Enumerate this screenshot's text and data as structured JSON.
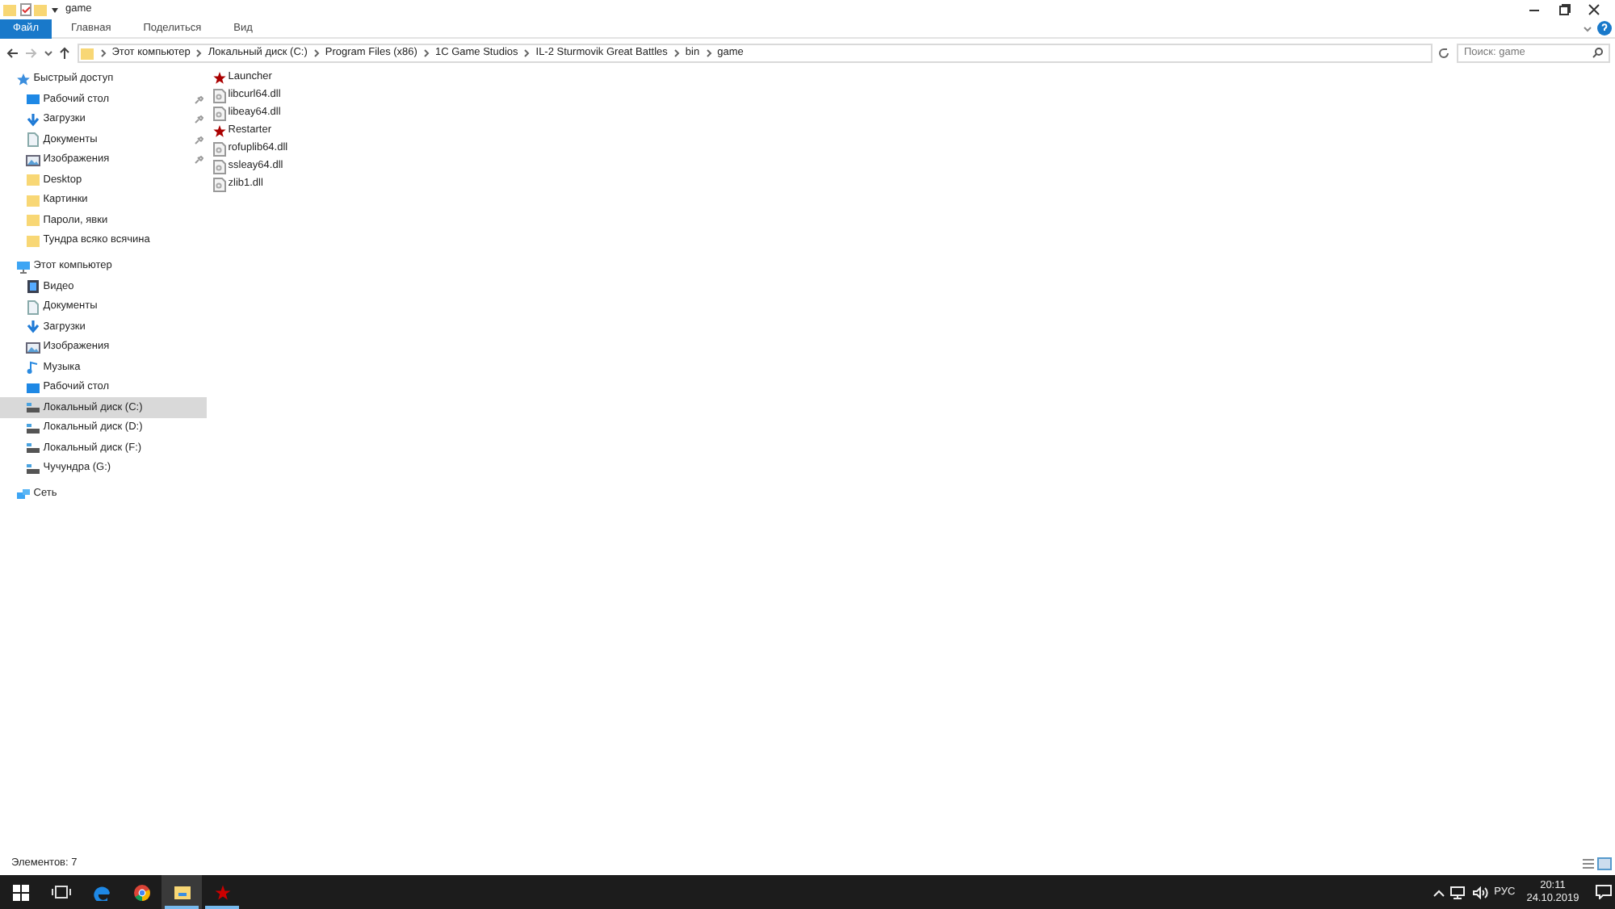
{
  "window": {
    "title": "game"
  },
  "ribbon_tabs": [
    {
      "label": "Файл",
      "selected": true
    },
    {
      "label": "Главная",
      "selected": false
    },
    {
      "label": "Поделиться",
      "selected": false
    },
    {
      "label": "Вид",
      "selected": false
    }
  ],
  "breadcrumbs": [
    "Этот компьютер",
    "Локальный диск (C:)",
    "Program Files (x86)",
    "1C Game Studios",
    "IL-2 Sturmovik Great Battles",
    "bin",
    "game"
  ],
  "search": {
    "placeholder": "Поиск: game"
  },
  "sidebar": {
    "groups": [
      {
        "label": "Быстрый доступ",
        "kind": "star",
        "items": [
          {
            "label": "Рабочий стол",
            "kind": "desktop",
            "pinned": true,
            "selected": false
          },
          {
            "label": "Загрузки",
            "kind": "download",
            "pinned": true,
            "selected": false
          },
          {
            "label": "Документы",
            "kind": "document",
            "pinned": true,
            "selected": false
          },
          {
            "label": "Изображения",
            "kind": "picture",
            "pinned": true,
            "selected": false
          },
          {
            "label": "Desktop",
            "kind": "folder",
            "pinned": false,
            "selected": false
          },
          {
            "label": "Картинки",
            "kind": "folder",
            "pinned": false,
            "selected": false
          },
          {
            "label": "Пароли, явки",
            "kind": "folder",
            "pinned": false,
            "selected": false
          },
          {
            "label": "Тундра всяко всячина",
            "kind": "folder",
            "pinned": false,
            "selected": false
          }
        ]
      },
      {
        "label": "Этот компьютер",
        "kind": "pc",
        "items": [
          {
            "label": "Видео",
            "kind": "video",
            "pinned": false,
            "selected": false
          },
          {
            "label": "Документы",
            "kind": "document",
            "pinned": false,
            "selected": false
          },
          {
            "label": "Загрузки",
            "kind": "download",
            "pinned": false,
            "selected": false
          },
          {
            "label": "Изображения",
            "kind": "picture",
            "pinned": false,
            "selected": false
          },
          {
            "label": "Музыка",
            "kind": "music",
            "pinned": false,
            "selected": false
          },
          {
            "label": "Рабочий стол",
            "kind": "desktop",
            "pinned": false,
            "selected": false
          },
          {
            "label": "Локальный диск (C:)",
            "kind": "drive",
            "pinned": false,
            "selected": true
          },
          {
            "label": "Локальный диск (D:)",
            "kind": "drive",
            "pinned": false,
            "selected": false
          },
          {
            "label": "Локальный диск (F:)",
            "kind": "drive",
            "pinned": false,
            "selected": false
          },
          {
            "label": "Чучундра (G:)",
            "kind": "drive",
            "pinned": false,
            "selected": false
          }
        ]
      },
      {
        "label": "Сеть",
        "kind": "network"
      }
    ]
  },
  "files": [
    {
      "name": "Launcher",
      "kind": "app"
    },
    {
      "name": "libcurl64.dll",
      "kind": "dll"
    },
    {
      "name": "libeay64.dll",
      "kind": "dll"
    },
    {
      "name": "Restarter",
      "kind": "app"
    },
    {
      "name": "rofuplib64.dll",
      "kind": "dll"
    },
    {
      "name": "ssleay64.dll",
      "kind": "dll"
    },
    {
      "name": "zlib1.dll",
      "kind": "dll"
    }
  ],
  "status_bar": {
    "count": "Элементов: 7"
  },
  "taskbar": {
    "apps": [
      {
        "kind": "edge",
        "active": false,
        "running": false
      },
      {
        "kind": "chrome",
        "active": false,
        "running": false
      },
      {
        "kind": "explorer",
        "active": true,
        "running": true
      },
      {
        "kind": "star",
        "active": false,
        "running": true
      }
    ],
    "language": "РУС",
    "time": "20:11",
    "date": "24.10.2019"
  }
}
